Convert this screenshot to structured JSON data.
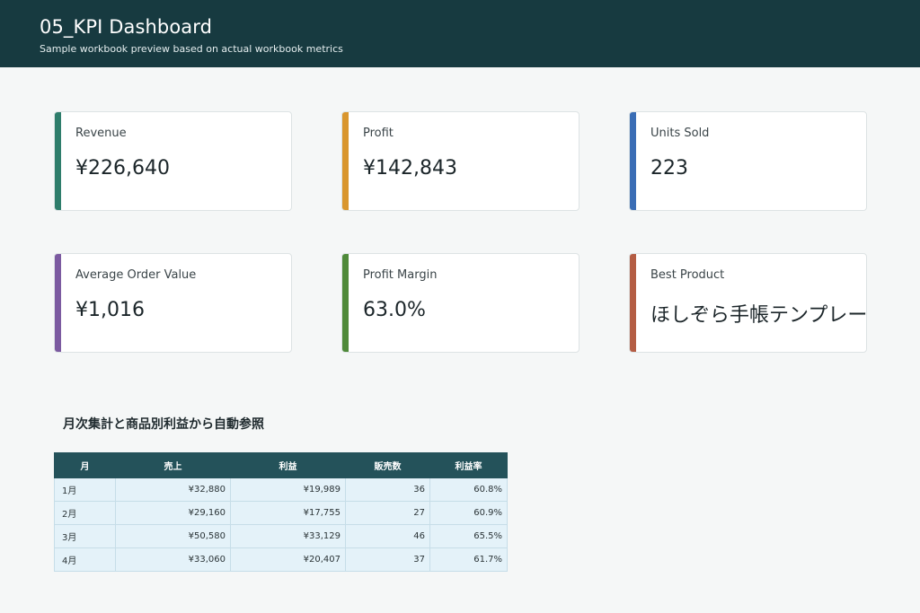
{
  "header": {
    "title": "05_KPI Dashboard",
    "subtitle": "Sample workbook preview based on actual workbook metrics"
  },
  "kpis": [
    {
      "label": "Revenue",
      "value": "¥226,640",
      "accent": "#2e7d6b"
    },
    {
      "label": "Profit",
      "value": "¥142,843",
      "accent": "#d9962e"
    },
    {
      "label": "Units Sold",
      "value": "223",
      "accent": "#3a6db5"
    },
    {
      "label": "Average Order Value",
      "value": "¥1,016",
      "accent": "#7b5aa0"
    },
    {
      "label": "Profit Margin",
      "value": "63.0%",
      "accent": "#4f8a3a"
    },
    {
      "label": "Best Product",
      "value": "ほしぞら手帳テンプレート",
      "accent": "#b45d44"
    }
  ],
  "section": {
    "title": "月次集計と商品別利益から自動参照"
  },
  "table": {
    "headers": [
      "月",
      "売上",
      "利益",
      "販売数",
      "利益率"
    ],
    "rows": [
      [
        "1月",
        "¥32,880",
        "¥19,989",
        "36",
        "60.8%"
      ],
      [
        "2月",
        "¥29,160",
        "¥17,755",
        "27",
        "60.9%"
      ],
      [
        "3月",
        "¥50,580",
        "¥33,129",
        "46",
        "65.5%"
      ],
      [
        "4月",
        "¥33,060",
        "¥20,407",
        "37",
        "61.7%"
      ]
    ]
  }
}
